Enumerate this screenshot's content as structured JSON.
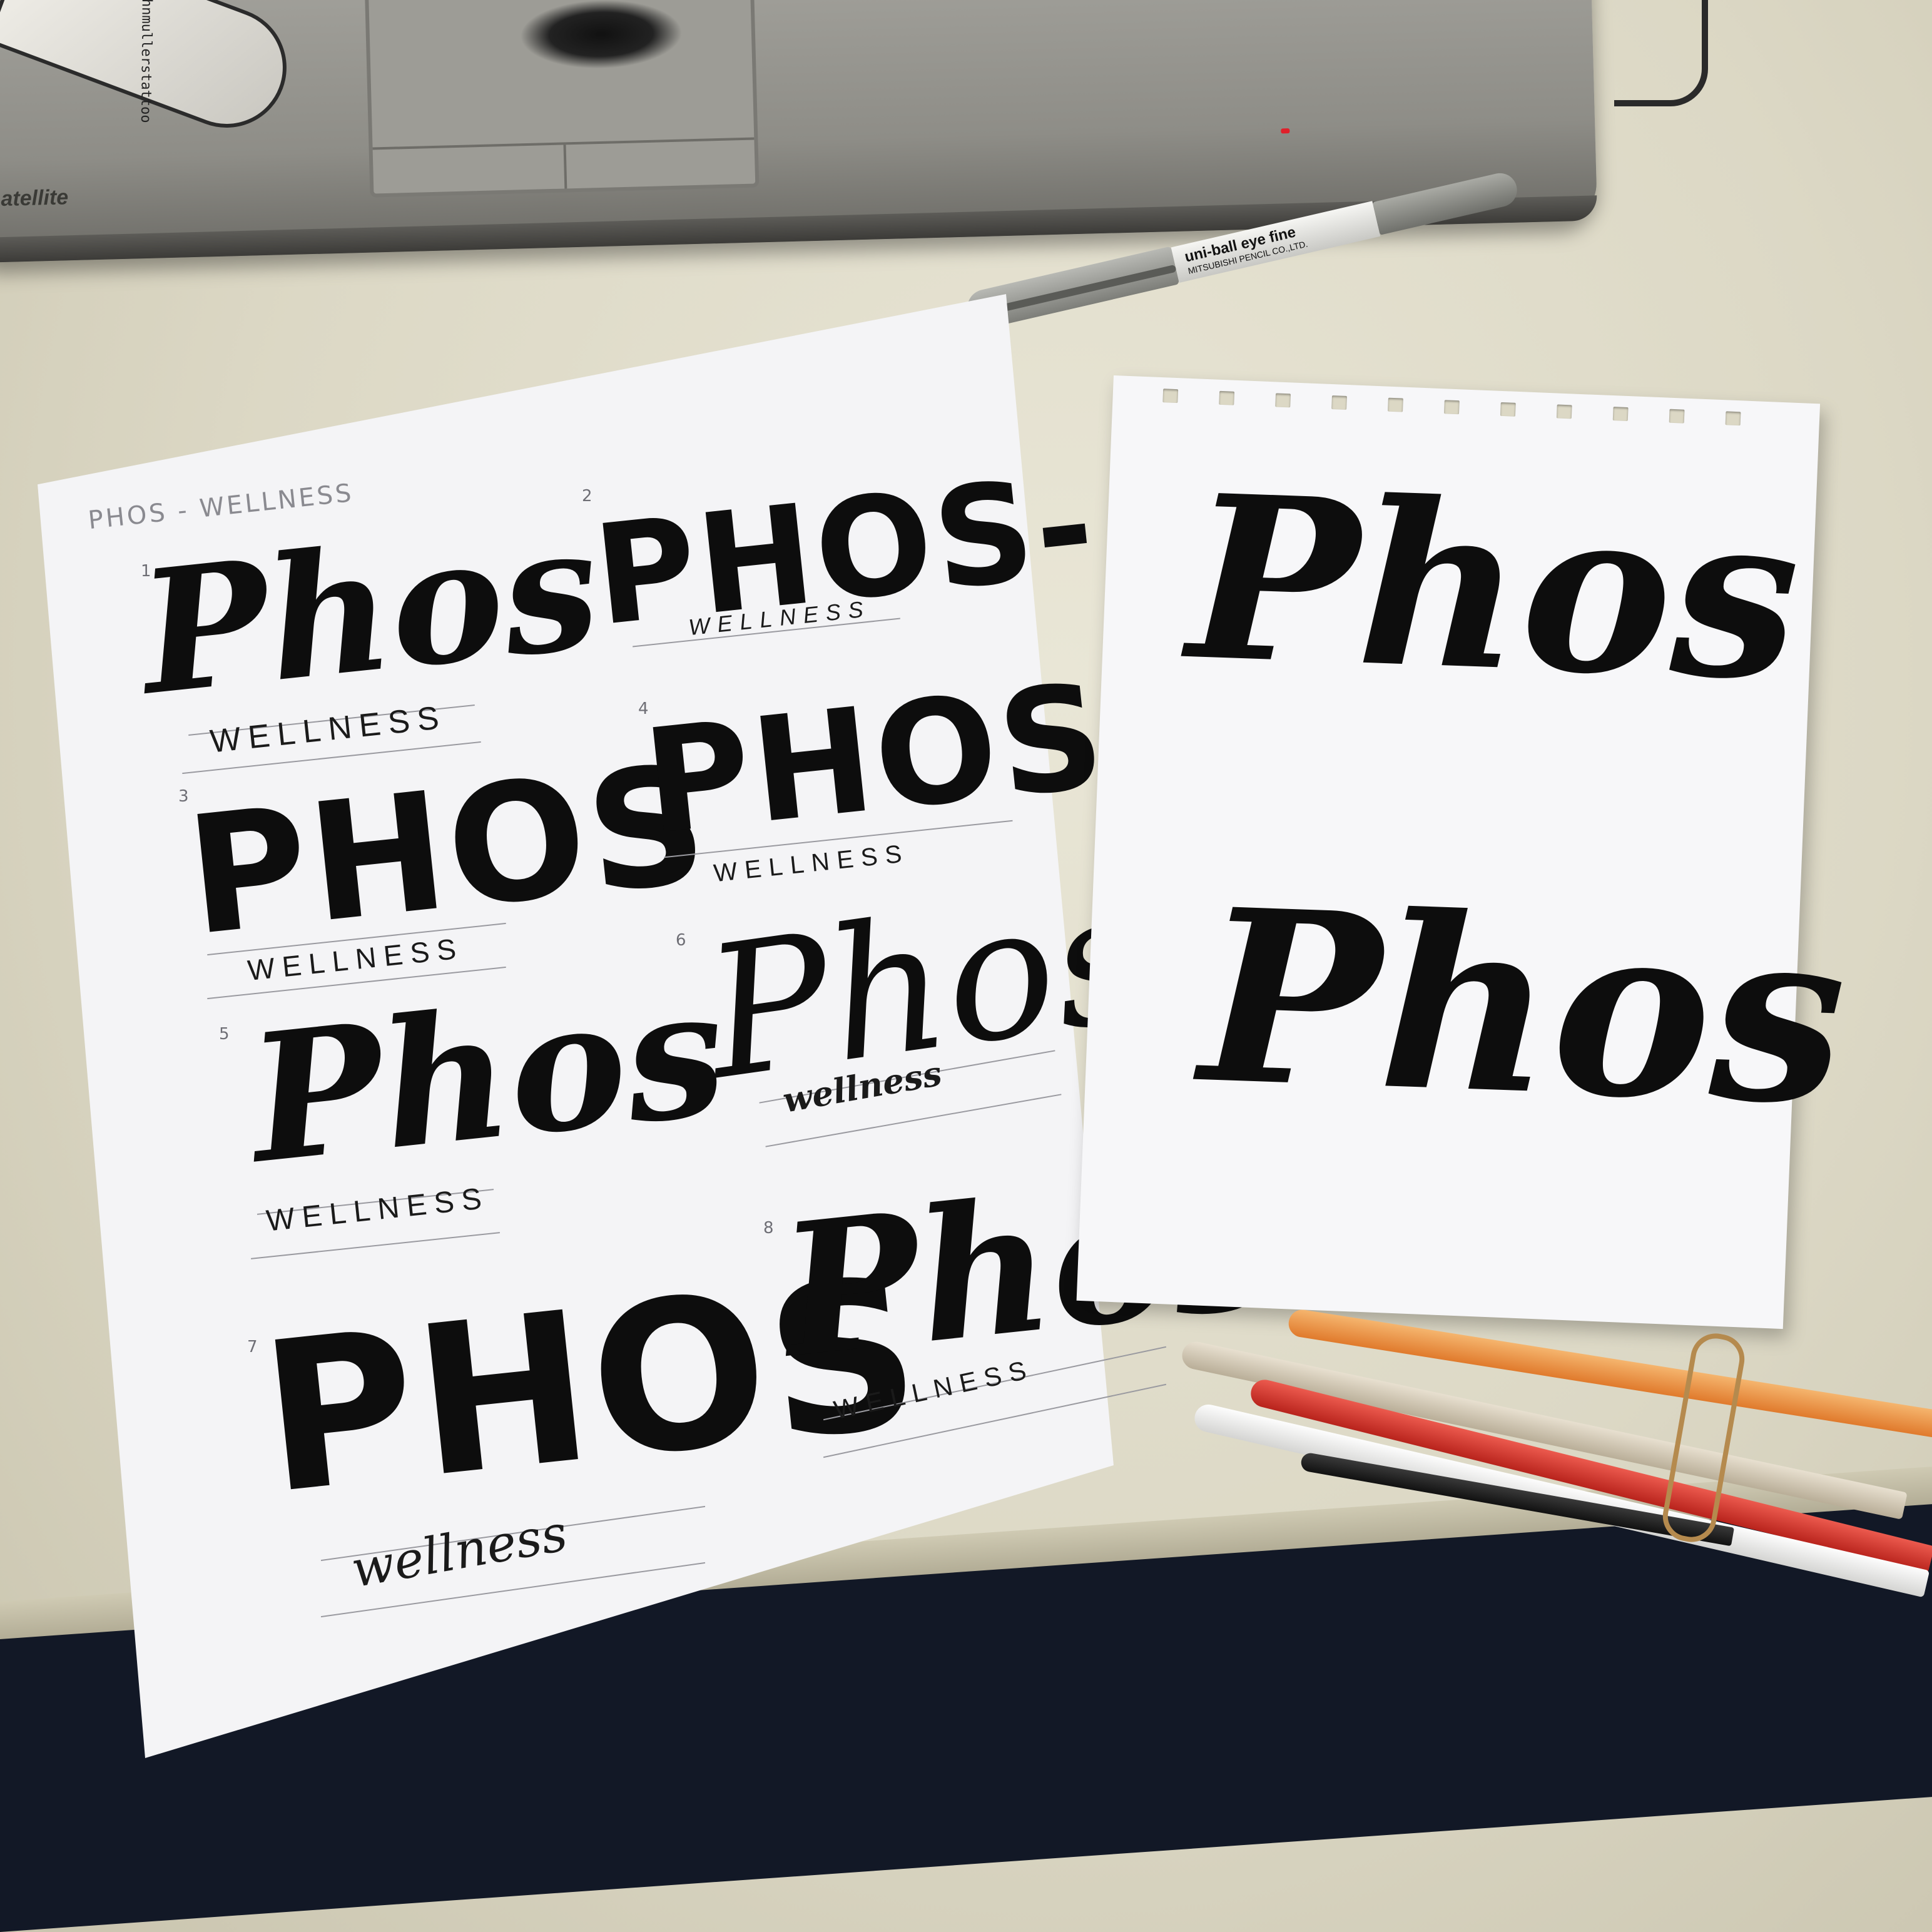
{
  "laptop": {
    "brand_fragment": "atellite",
    "sticker_text": "©johnmullerstattoo"
  },
  "pen": {
    "brand": "uni-ball eye fine",
    "maker": "MITSUBISHI PENCIL CO.,LTD."
  },
  "sketch_sheet": {
    "heading": "PHOS - WELLNESS",
    "sketches": [
      {
        "number": "1",
        "wordmark": "Phos",
        "tagline": "WELLNESS"
      },
      {
        "number": "2",
        "wordmark": "PHOS-",
        "tagline": "WELLNESS"
      },
      {
        "number": "3",
        "wordmark": "PHOS",
        "tagline": "WELLNESS"
      },
      {
        "number": "4",
        "wordmark": "PHOS",
        "tagline": "WELLNESS"
      },
      {
        "number": "5",
        "wordmark": "Phos",
        "tagline": "WELLNESS"
      },
      {
        "number": "6",
        "wordmark": "Phos",
        "tagline": "wellness"
      },
      {
        "number": "7",
        "wordmark": "PHOS",
        "tagline": "wellness"
      },
      {
        "number": "8",
        "wordmark": "Phos",
        "tagline": "WELLNESS"
      }
    ]
  },
  "final_sheet": {
    "wordmarks": [
      "Phos",
      "Phos"
    ]
  },
  "colors": {
    "ink": "#0d0d0d",
    "paper": "#f4f4f6",
    "desk": "#dcd8c5",
    "pencil_red": "#d9342b",
    "pencil_orange": "#f08a3c"
  }
}
